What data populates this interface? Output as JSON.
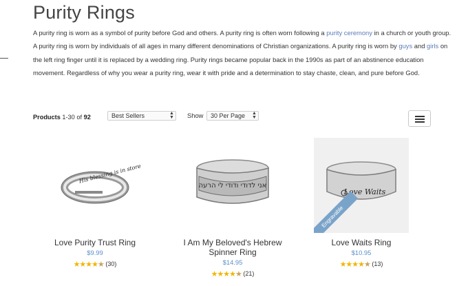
{
  "page": {
    "title": "Purity Rings",
    "intro": {
      "p1": "A purity ring is worn as a symbol of purity before God and others. A purity ring is often worn following a ",
      "link_ceremony": "purity ceremony",
      "p2": " in a church or youth group. A purity ring is worn by individuals of all ages in many different denominations of Christian organizations. A purity ring is worn by ",
      "link_guys": "guys",
      "p3": " and ",
      "link_girls": "girls",
      "p4": " on the left ring finger until it is replaced by a wedding ring. Purity rings became popular back in the 1990s as part of an abstinence education movement. Regardless of why you wear a purity ring, wear it with pride and a determination to stay chaste, clean, and pure before God."
    }
  },
  "toolbar": {
    "products_label": "Products",
    "range": "1-30",
    "of_label": "of",
    "total": "92",
    "sort_value": "Best Sellers",
    "show_label": "Show",
    "per_page_value": "30 Per Page",
    "view_icon": "list-view-icon"
  },
  "products": [
    {
      "name": "Love Purity Trust Ring",
      "price": "$9.99",
      "rating": 4.5,
      "reviews": "(30)",
      "engraving": "His blessing is in store"
    },
    {
      "name": "I Am My Beloved's Hebrew Spinner Ring",
      "name_line1": "I Am My Beloved's Hebrew",
      "name_line2": "Spinner Ring",
      "price": "$14.95",
      "rating": 4.5,
      "reviews": "(21)",
      "engraving": "אני לדודי ודודי לי הרעה"
    },
    {
      "name": "Love Waits Ring",
      "price": "$10.95",
      "rating": 4.5,
      "reviews": "(13)",
      "badge": "Engravable",
      "engraving": "Love Waits"
    }
  ],
  "colors": {
    "link": "#5b7db8",
    "price": "#5b8fc9",
    "star": "#f2b500",
    "badge": "#7aa3c9"
  }
}
